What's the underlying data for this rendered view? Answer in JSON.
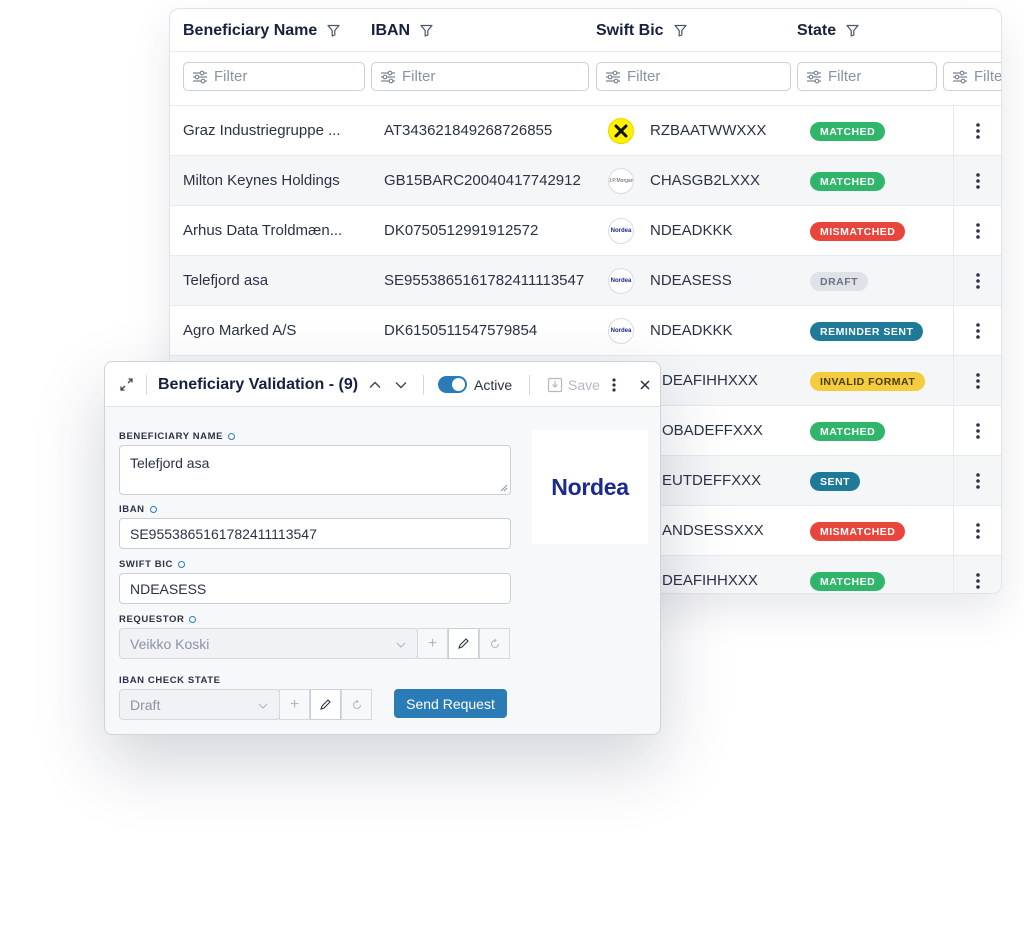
{
  "grid": {
    "columns": [
      {
        "label": "Beneficiary Name"
      },
      {
        "label": "IBAN"
      },
      {
        "label": "Swift Bic"
      },
      {
        "label": "State"
      }
    ],
    "filter_placeholder": "Filter",
    "filter_placeholder_partial": "Filte",
    "rows": [
      {
        "name": "Graz Industriegruppe ...",
        "iban": "AT343621849268726855",
        "bank_logo": "raiffeisen-logo",
        "swift": "RZBAATWWXXX",
        "state": "MATCHED",
        "state_color": "#2fb66a"
      },
      {
        "name": "Milton Keynes Holdings",
        "iban": "GB15BARC20040417742912",
        "bank_logo": "jpmorgan-logo",
        "logo_text": "J.P.Morgan",
        "swift": "CHASGB2LXXX",
        "state": "MATCHED",
        "state_color": "#2fb66a"
      },
      {
        "name": "Arhus Data Troldmæn...",
        "iban": "DK0750512991912572",
        "bank_logo": "nordea-logo",
        "logo_text": "Nordea",
        "swift": "NDEADKKK",
        "state": "MISMATCHED",
        "state_color": "#e8453c"
      },
      {
        "name": "Telefjord asa",
        "iban": "SE9553865161782411113547",
        "bank_logo": "nordea-logo",
        "logo_text": "Nordea",
        "swift": "NDEASESS",
        "state": "DRAFT",
        "state_color": "#dfe2e7"
      },
      {
        "name": "Agro Marked A/S",
        "iban": "DK6150511547579854",
        "bank_logo": "nordea-logo",
        "logo_text": "Nordea",
        "swift": "NDEADKKK",
        "state": "REMINDER SENT",
        "state_color": "#1f7a99"
      },
      {
        "name": "",
        "iban": "",
        "swift": "DEAFIHHXXX",
        "state": "INVALID FORMAT",
        "state_color": "#f3cd3f"
      },
      {
        "name": "",
        "iban": "",
        "swift": "OBADEFFXXX",
        "state": "MATCHED",
        "state_color": "#2fb66a"
      },
      {
        "name": "",
        "iban": "",
        "swift": "EUTDEFFXXX",
        "state": "SENT",
        "state_color": "#1f7a99"
      },
      {
        "name": "",
        "iban": "",
        "swift": "ANDSESSXXX",
        "state": "MISMATCHED",
        "state_color": "#e8453c"
      },
      {
        "name": "",
        "iban": "",
        "swift": "DEAFIHHXXX",
        "state": "MATCHED",
        "state_color": "#2fb66a"
      }
    ]
  },
  "dialog": {
    "title": "Beneficiary Validation - (9)",
    "active_label": "Active",
    "save_label": "Save",
    "beneficiary_name_label": "BENEFICIARY NAME",
    "beneficiary_name_value": "Telefjord asa",
    "iban_label": "IBAN",
    "iban_value": "SE9553865161782411113547",
    "swift_label": "SWIFT BIC",
    "swift_value": "NDEASESS",
    "requestor_label": "REQUESTOR",
    "requestor_value": "Veikko Koski",
    "iban_check_label": "IBAN CHECK STATE",
    "iban_check_value": "Draft",
    "send_label": "Send Request",
    "bank_name": "Nordea",
    "accent_color": "#2b7cb6"
  }
}
